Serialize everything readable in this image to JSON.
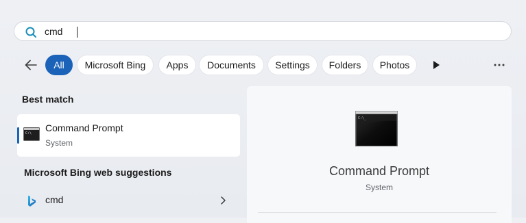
{
  "search": {
    "value": "cmd"
  },
  "filters": {
    "chips": [
      "All",
      "Microsoft Bing",
      "Apps",
      "Documents",
      "Settings",
      "Folders",
      "Photos"
    ],
    "active": "All"
  },
  "best_match": {
    "heading": "Best match",
    "title": "Command Prompt",
    "subtitle": "System",
    "icon": "command-prompt-icon"
  },
  "web_suggestions": {
    "heading": "Microsoft Bing web suggestions",
    "items": [
      {
        "label": "cmd",
        "icon": "bing-icon"
      }
    ]
  },
  "detail": {
    "title": "Command Prompt",
    "subtitle": "System"
  },
  "colors": {
    "accent": "#1a63b8",
    "search_icon": "#1a8fb8"
  }
}
